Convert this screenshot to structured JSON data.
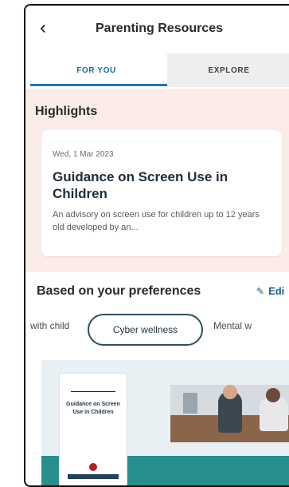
{
  "header": {
    "title": "Parenting Resources",
    "back_icon": "‹"
  },
  "tabs": [
    {
      "label": "FOR YOU",
      "active": true
    },
    {
      "label": "EXPLORE",
      "active": false
    }
  ],
  "highlights": {
    "title": "Highlights",
    "card": {
      "date": "Wed, 1 Mar 2023",
      "title": "Guidance on Screen Use in Children",
      "description": "An advisory on screen use for children up to 12 years old developed by an..."
    }
  },
  "preferences": {
    "title": "Based on your preferences",
    "edit_label": "Edi",
    "chips": [
      {
        "label": "with child",
        "selected": false
      },
      {
        "label": "Cyber wellness",
        "selected": true
      },
      {
        "label": "Mental w",
        "selected": false
      }
    ]
  },
  "media": {
    "poster_text": "Guidance on Screen Use in Children"
  },
  "colors": {
    "accent": "#1e73be",
    "highlight_bg": "#fbece9",
    "teal": "#27908f"
  }
}
